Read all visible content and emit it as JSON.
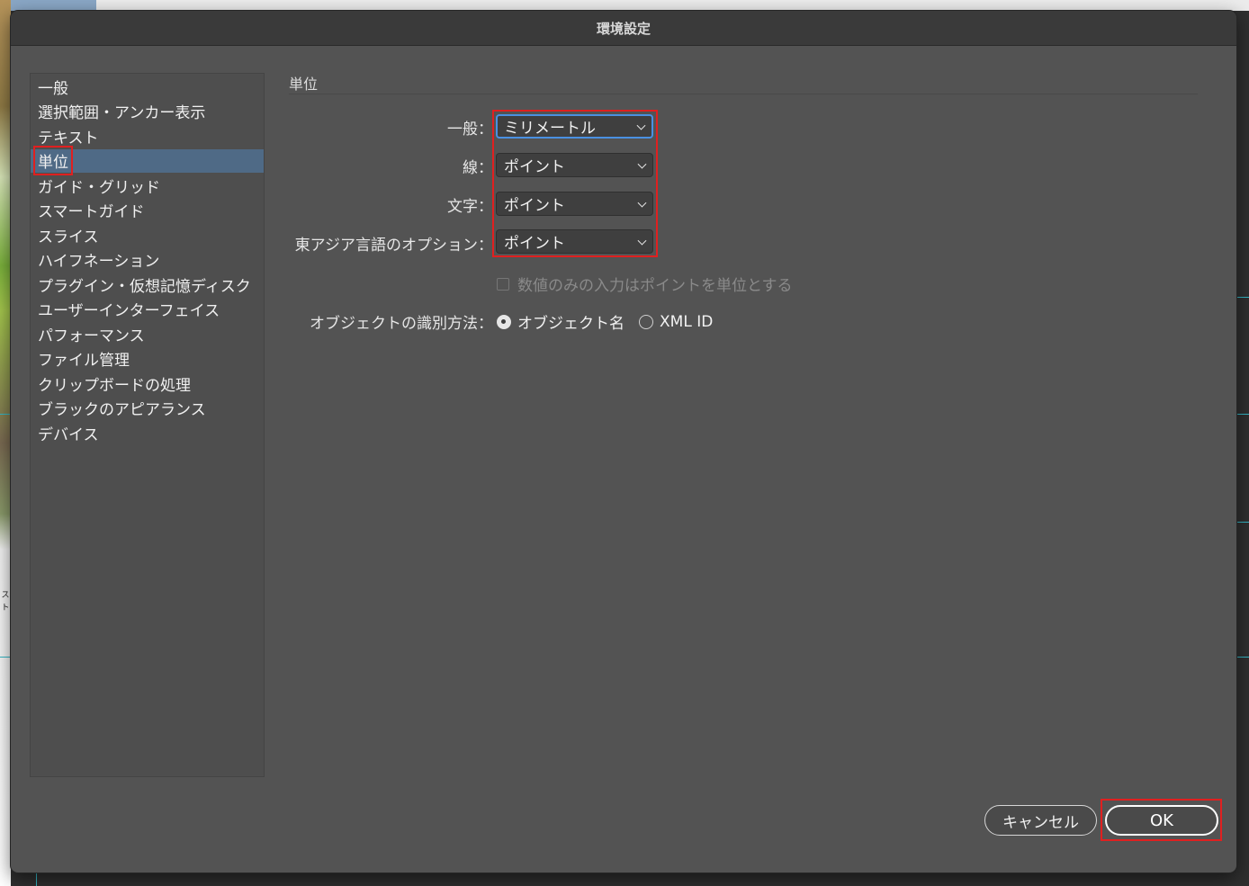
{
  "dialog": {
    "title": "環境設定"
  },
  "sidebar": {
    "items": [
      {
        "label": "一般"
      },
      {
        "label": "選択範囲・アンカー表示"
      },
      {
        "label": "テキスト"
      },
      {
        "label": "単位",
        "selected": true
      },
      {
        "label": "ガイド・グリッド"
      },
      {
        "label": "スマートガイド"
      },
      {
        "label": "スライス"
      },
      {
        "label": "ハイフネーション"
      },
      {
        "label": "プラグイン・仮想記憶ディスク"
      },
      {
        "label": "ユーザーインターフェイス"
      },
      {
        "label": "パフォーマンス"
      },
      {
        "label": "ファイル管理"
      },
      {
        "label": "クリップボードの処理"
      },
      {
        "label": "ブラックのアピアランス"
      },
      {
        "label": "デバイス"
      }
    ]
  },
  "panel": {
    "section_title": "単位",
    "rows": [
      {
        "label": "一般：",
        "value": "ミリメートル"
      },
      {
        "label": "線：",
        "value": "ポイント"
      },
      {
        "label": "文字：",
        "value": "ポイント"
      },
      {
        "label": "東アジア言語のオプション：",
        "value": "ポイント"
      }
    ],
    "checkbox": {
      "label": "数値のみの入力はポイントを単位とする",
      "checked": false,
      "enabled": false
    },
    "object_id": {
      "label": "オブジェクトの識別方法：",
      "options": [
        {
          "label": "オブジェクト名",
          "checked": true
        },
        {
          "label": "XML ID",
          "checked": false
        }
      ]
    }
  },
  "buttons": {
    "cancel": "キャンセル",
    "ok": "OK"
  },
  "background": {
    "side_text": "ス\nト"
  },
  "colors": {
    "dialog_bg": "#535353",
    "selection_bg": "#4f6a86",
    "highlight": "#e02020",
    "focus": "#4a90e2"
  }
}
